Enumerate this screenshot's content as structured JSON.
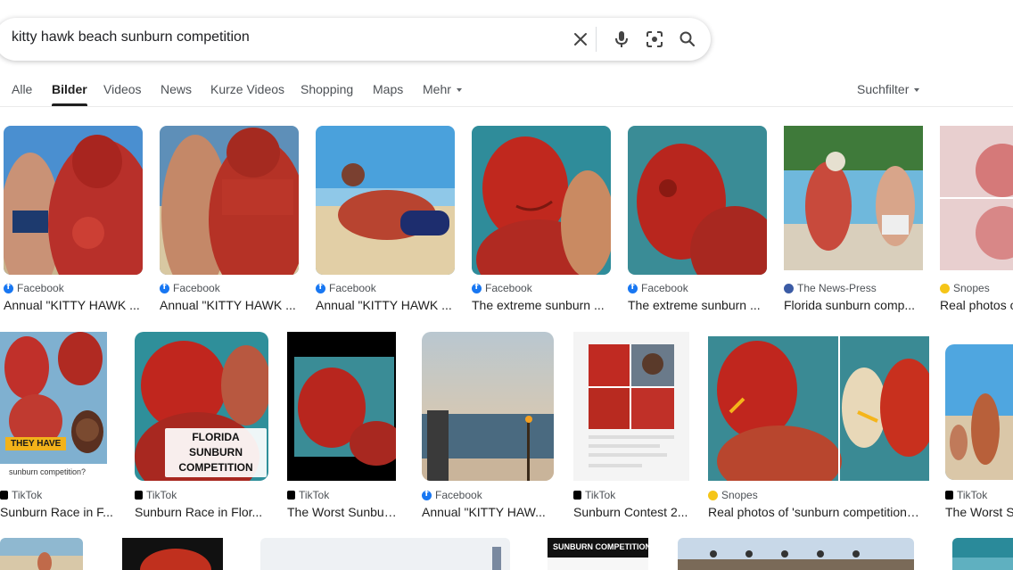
{
  "search": {
    "query": "kitty hawk beach sunburn competition"
  },
  "tabs": [
    {
      "label": "Alle"
    },
    {
      "label": "Bilder"
    },
    {
      "label": "Videos"
    },
    {
      "label": "News"
    },
    {
      "label": "Kurze Videos"
    },
    {
      "label": "Shopping"
    },
    {
      "label": "Maps"
    },
    {
      "label": "Mehr"
    }
  ],
  "filter_label": "Suchfilter",
  "row1": [
    {
      "source": "Facebook",
      "title": "Annual \"KITTY HAWK ..."
    },
    {
      "source": "Facebook",
      "title": "Annual \"KITTY HAWK ..."
    },
    {
      "source": "Facebook",
      "title": "Annual \"KITTY HAWK ..."
    },
    {
      "source": "Facebook",
      "title": "The extreme sunburn ..."
    },
    {
      "source": "Facebook",
      "title": "The extreme sunburn ..."
    },
    {
      "source": "The News-Press",
      "title": "Florida sunburn comp..."
    },
    {
      "source": "Snopes",
      "title": "Real photos o"
    }
  ],
  "row2": [
    {
      "source": "TikTok",
      "title": "Sunburn Race in F..."
    },
    {
      "source": "TikTok",
      "title": "Sunburn Race in Flor..."
    },
    {
      "source": "TikTok",
      "title": "The Worst Sunbur..."
    },
    {
      "source": "Facebook",
      "title": "Annual \"KITTY HAW..."
    },
    {
      "source": "TikTok",
      "title": "Sunburn Contest 2..."
    },
    {
      "source": "Snopes",
      "title": "Real photos of 'sunburn competition i..."
    },
    {
      "source": "TikTok",
      "title": "The Worst S"
    }
  ],
  "overlays": {
    "florida": "FLORIDA SUNBURN COMPETITION",
    "they_have": "THEY HAVE",
    "sunburn_comp_q": "sunburn competition?",
    "banner": "SUNBURN COMPETITION"
  },
  "colors": {
    "accent": "#1f1f1f",
    "facebook": "#1877f2"
  }
}
